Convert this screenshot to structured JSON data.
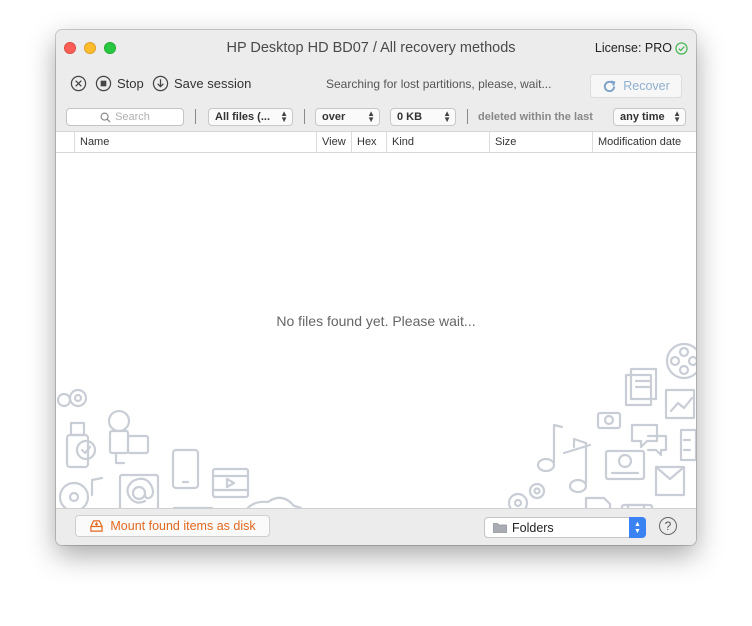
{
  "window": {
    "title": "HP Desktop HD BD07 / All recovery methods",
    "license_label": "License: PRO"
  },
  "toolbar": {
    "stop_label": "Stop",
    "save_session_label": "Save session",
    "status_text": "Searching for lost partitions, please, wait...",
    "recover_label": "Recover"
  },
  "filters": {
    "search_placeholder": "Search",
    "file_type": "All files (...",
    "size_operator": "over",
    "size_value": "0 KB",
    "deleted_label": "deleted within the last",
    "time_range": "any time"
  },
  "columns": {
    "name": "Name",
    "view": "View",
    "hex": "Hex",
    "kind": "Kind",
    "size": "Size",
    "modification_date": "Modification date"
  },
  "content": {
    "empty_message": "No files found yet. Please wait..."
  },
  "bottom": {
    "mount_label": "Mount found items as disk",
    "view_mode": "Folders",
    "help_label": "?"
  },
  "colors": {
    "accent_orange": "#e2681e",
    "recover_blue": "#8fb0cf",
    "license_green": "#3bb54a",
    "decoration_gray": "#c9ced6"
  }
}
